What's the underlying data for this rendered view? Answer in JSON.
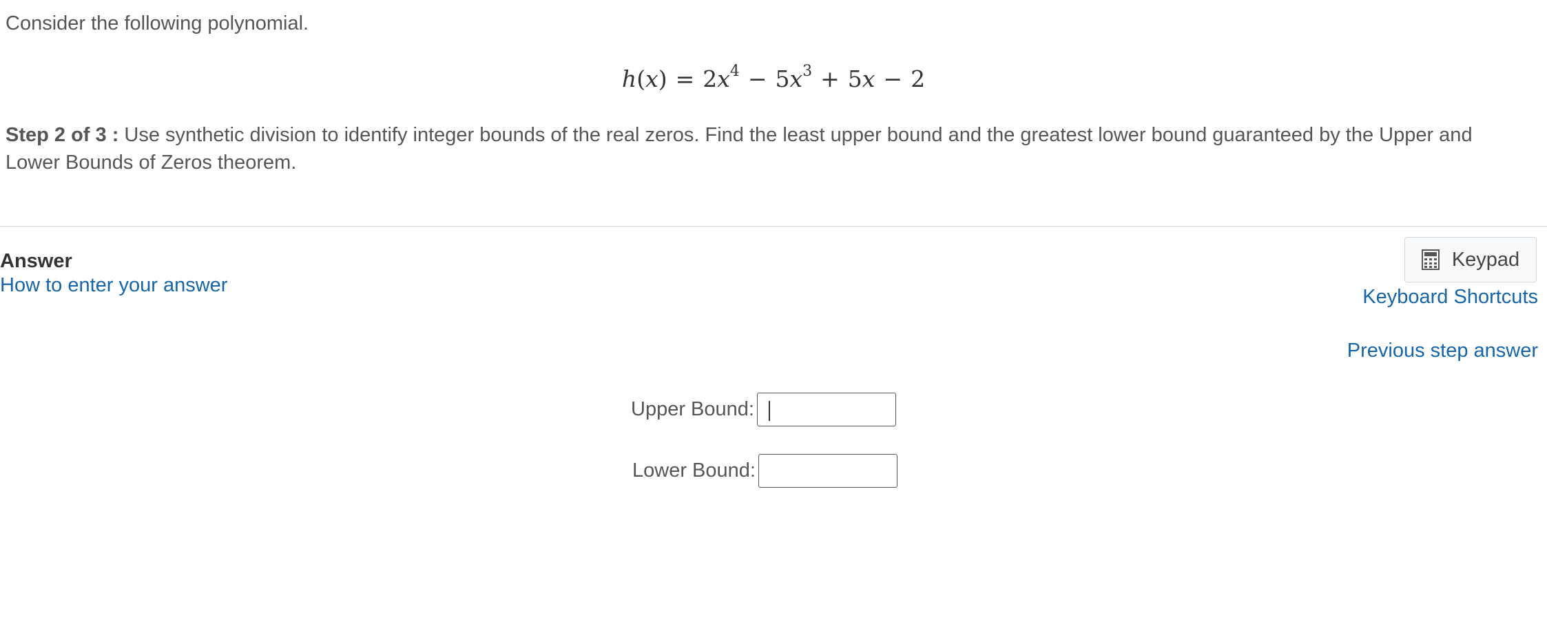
{
  "question": {
    "intro": "Consider the following polynomial.",
    "formula": {
      "lhs_func": "h",
      "lhs_var": "x",
      "equals": "=",
      "t1_coef": "2",
      "t1_var": "x",
      "t1_exp": "4",
      "op1": "−",
      "t2_coef": "5",
      "t2_var": "x",
      "t2_exp": "3",
      "op2": "+",
      "t3_coef": "5",
      "t3_var": "x",
      "op3": "−",
      "t4_const": "2"
    },
    "step_label": "Step 2 of 3 :",
    "step_text": "Use synthetic division to identify integer bounds of the real zeros. Find the least upper bound and the greatest lower bound guaranteed by the Upper and Lower Bounds of Zeros theorem."
  },
  "answer": {
    "title": "Answer",
    "how_to_link": "How to enter your answer",
    "keypad_label": "Keypad",
    "keypad_icon": "calculator-icon",
    "keyboard_shortcuts_link": "Keyboard Shortcuts",
    "previous_step_link": "Previous step answer",
    "upper_bound": {
      "label": "Upper Bound:",
      "value": ""
    },
    "lower_bound": {
      "label": "Lower Bound:",
      "value": ""
    }
  }
}
